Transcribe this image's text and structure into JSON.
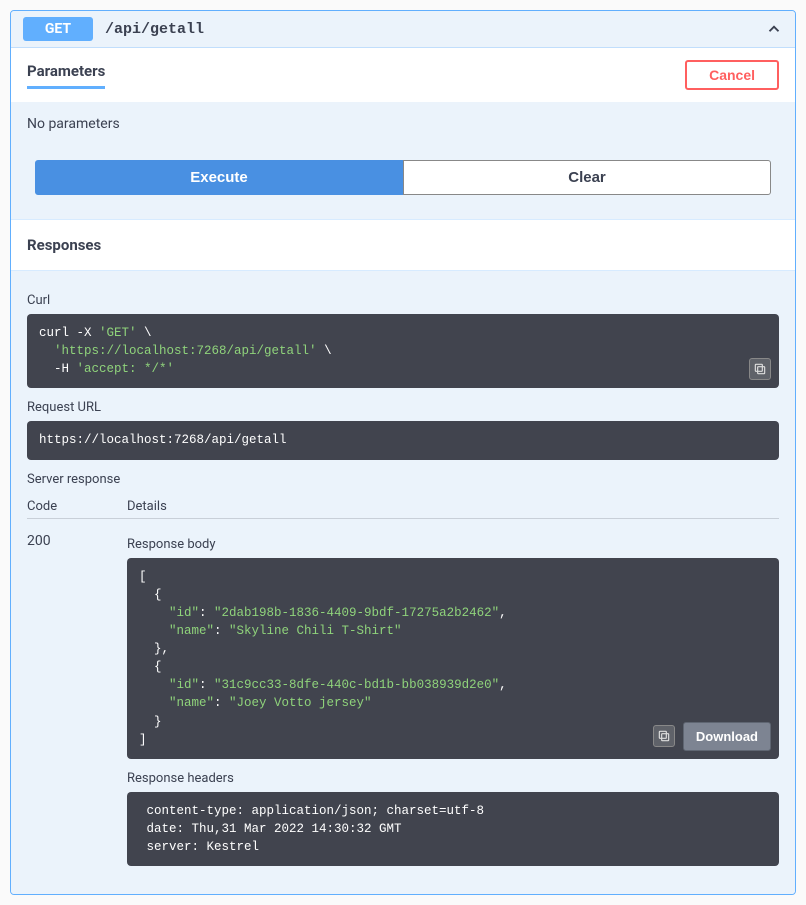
{
  "header": {
    "method": "GET",
    "path": "/api/getall"
  },
  "parameters": {
    "title": "Parameters",
    "cancel_label": "Cancel",
    "empty_text": "No parameters",
    "execute_label": "Execute",
    "clear_label": "Clear"
  },
  "responses": {
    "title": "Responses",
    "curl_label": "Curl",
    "curl_plain": "curl -X ",
    "curl_get": "'GET'",
    "curl_bs": " \\",
    "curl_indent": "  ",
    "curl_url": "'https://localhost:7268/api/getall'",
    "curl_h": "-H ",
    "curl_accept": "'accept: */*'",
    "request_url_label": "Request URL",
    "request_url": "https://localhost:7268/api/getall",
    "server_response_label": "Server response",
    "code_col": "Code",
    "details_col": "Details",
    "status_code": "200",
    "response_body_label": "Response body",
    "download_label": "Download",
    "body": {
      "l0": "[",
      "l1": "  {",
      "l2_k": "    \"id\"",
      "l2_c": ": ",
      "l2_v": "\"2dab198b-1836-4409-9bdf-17275a2b2462\"",
      "comma": ",",
      "l3_k": "    \"name\"",
      "l3_v": "\"Skyline Chili T-Shirt\"",
      "l4": "  },",
      "l5": "  {",
      "l6_v": "\"31c9cc33-8dfe-440c-bd1b-bb038939d2e0\"",
      "l7_v": "\"Joey Votto jersey\"",
      "l8": "  }",
      "l9": "]"
    },
    "response_headers_label": "Response headers",
    "headers_text": " content-type: application/json; charset=utf-8 \n date: Thu,31 Mar 2022 14:30:32 GMT \n server: Kestrel "
  }
}
